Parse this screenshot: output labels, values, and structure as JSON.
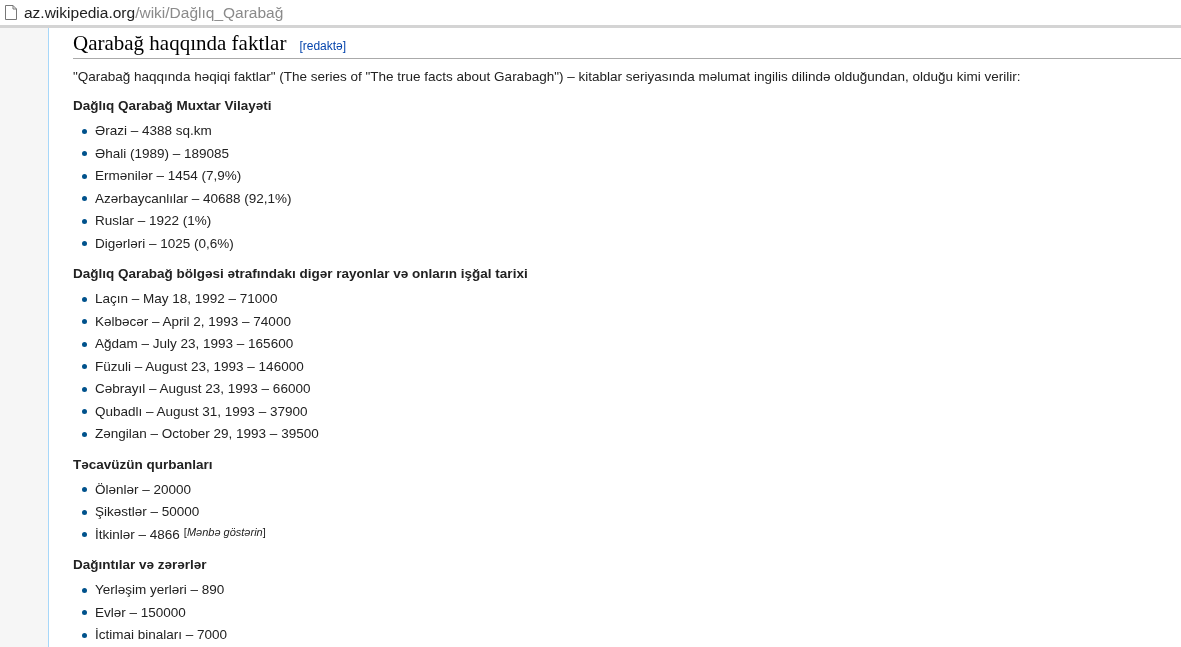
{
  "address_bar": {
    "host": "az.wikipedia.org",
    "path": "/wiki/Dağlıq_Qarabağ"
  },
  "article": {
    "heading": "Qarabağ haqqında faktlar",
    "edit_link": "[redaktə]",
    "intro": "\"Qarabağ haqqında həqiqi faktlar\" (The series of \"The true facts about Garabagh\") – kitablar seriyasında məlumat ingilis dilində olduğundan, olduğu kimi verilir:",
    "sections": [
      {
        "title": "Dağlıq Qarabağ Muxtar Vilayəti",
        "items": [
          {
            "text": "Ərazi – 4388 sq.km"
          },
          {
            "text": "Əhali (1989) – 189085"
          },
          {
            "text": "Ermənilər – 1454 (7,9%)"
          },
          {
            "text": "Azərbaycanlılar – 40688 (92,1%)"
          },
          {
            "text": "Ruslar – 1922 (1%)"
          },
          {
            "text": "Digərləri – 1025 (0,6%)"
          }
        ]
      },
      {
        "title": "Dağlıq Qarabağ bölgəsi ətrafındakı digər rayonlar və onların işğal tarixi",
        "items": [
          {
            "text": "Laçın – May 18, 1992 – 71000"
          },
          {
            "text": "Kəlbəcər – April 2, 1993 – 74000"
          },
          {
            "text": "Ağdam – July 23, 1993 – 165600"
          },
          {
            "text": "Füzuli – August 23, 1993 – 146000"
          },
          {
            "text": "Cəbrayıl – August 23, 1993 – 66000"
          },
          {
            "text": "Qubadlı – August 31, 1993 – 37900"
          },
          {
            "text": "Zəngilan – October 29, 1993 – 39500"
          }
        ]
      },
      {
        "title": "Təcavüzün qurbanları",
        "items": [
          {
            "text": "Ölənlər – 20000"
          },
          {
            "text": "Şikəstlər – 50000"
          },
          {
            "text": "İtkinlər – 4866",
            "citation": "[*Mənbə göstərin*]"
          }
        ]
      },
      {
        "title": "Dağıntılar və zərərlər",
        "items": [
          {
            "text": "Yerləşim yerləri – 890"
          },
          {
            "text": "Evlər – 150000"
          },
          {
            "text": "İctimai binaları – 7000"
          }
        ]
      }
    ]
  }
}
